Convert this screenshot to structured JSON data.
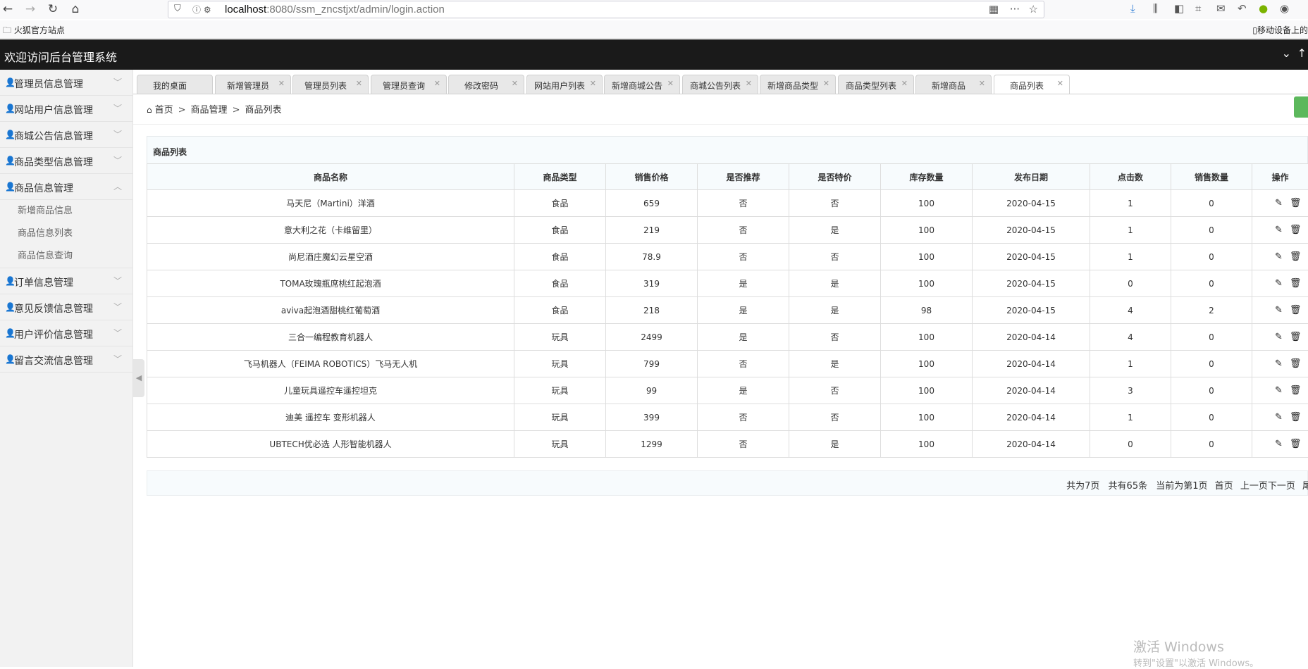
{
  "browser": {
    "url_host": "localhost",
    "url_rest": ":8080/ssm_zncstjxt/admin/login.action",
    "bookmark": "火狐官方站点",
    "mobile_bookmarks": "移动设备上的"
  },
  "app": {
    "title": "欢迎访问后台管理系统"
  },
  "sidebar": {
    "items": [
      {
        "label": "管理员信息管理",
        "expanded": false
      },
      {
        "label": "网站用户信息管理",
        "expanded": false
      },
      {
        "label": "商城公告信息管理",
        "expanded": false
      },
      {
        "label": "商品类型信息管理",
        "expanded": false
      },
      {
        "label": "商品信息管理",
        "expanded": true
      },
      {
        "label": "订单信息管理",
        "expanded": false
      },
      {
        "label": "意见反馈信息管理",
        "expanded": false
      },
      {
        "label": "用户评价信息管理",
        "expanded": false
      },
      {
        "label": "留言交流信息管理",
        "expanded": false
      }
    ],
    "submenu": [
      "新增商品信息",
      "商品信息列表",
      "商品信息查询"
    ]
  },
  "tabs": [
    {
      "label": "我的桌面",
      "closable": false
    },
    {
      "label": "新增管理员",
      "closable": true
    },
    {
      "label": "管理员列表",
      "closable": true
    },
    {
      "label": "管理员查询",
      "closable": true
    },
    {
      "label": "修改密码",
      "closable": true
    },
    {
      "label": "网站用户列表",
      "closable": true
    },
    {
      "label": "新增商城公告",
      "closable": true
    },
    {
      "label": "商城公告列表",
      "closable": true
    },
    {
      "label": "新增商品类型",
      "closable": true
    },
    {
      "label": "商品类型列表",
      "closable": true
    },
    {
      "label": "新增商品",
      "closable": true
    },
    {
      "label": "商品列表",
      "closable": true,
      "active": true
    }
  ],
  "breadcrumb": [
    "首页",
    "商品管理",
    "商品列表"
  ],
  "table": {
    "title": "商品列表",
    "headers": [
      "商品名称",
      "商品类型",
      "销售价格",
      "是否推荐",
      "是否特价",
      "库存数量",
      "发布日期",
      "点击数",
      "销售数量",
      "操作"
    ],
    "rows": [
      [
        "马天尼（Martini）洋酒",
        "食品",
        "659",
        "否",
        "否",
        "100",
        "2020-04-15",
        "1",
        "0"
      ],
      [
        "意大利之花（卡维留里）",
        "食品",
        "219",
        "否",
        "是",
        "100",
        "2020-04-15",
        "1",
        "0"
      ],
      [
        "尚尼酒庄魔幻云星空酒",
        "食品",
        "78.9",
        "否",
        "否",
        "100",
        "2020-04-15",
        "1",
        "0"
      ],
      [
        "TOMA玫瑰瓶席桃红起泡酒",
        "食品",
        "319",
        "是",
        "是",
        "100",
        "2020-04-15",
        "0",
        "0"
      ],
      [
        "aviva起泡酒甜桃红葡萄酒",
        "食品",
        "218",
        "是",
        "是",
        "98",
        "2020-04-15",
        "4",
        "2"
      ],
      [
        "三合一编程教育机器人",
        "玩具",
        "2499",
        "是",
        "否",
        "100",
        "2020-04-14",
        "4",
        "0"
      ],
      [
        "飞马机器人（FEIMA ROBOTICS）飞马无人机",
        "玩具",
        "799",
        "否",
        "是",
        "100",
        "2020-04-14",
        "1",
        "0"
      ],
      [
        "儿童玩具遥控车遥控坦克",
        "玩具",
        "99",
        "是",
        "否",
        "100",
        "2020-04-14",
        "3",
        "0"
      ],
      [
        "迪美 遥控车 变形机器人",
        "玩具",
        "399",
        "否",
        "否",
        "100",
        "2020-04-14",
        "1",
        "0"
      ],
      [
        "UBTECH优必选 人形智能机器人",
        "玩具",
        "1299",
        "否",
        "是",
        "100",
        "2020-04-14",
        "0",
        "0"
      ]
    ]
  },
  "pager": {
    "total_pages": "共为7页",
    "total_records": "共有65条",
    "current": "当前为第1页",
    "first": "首页",
    "prev": "上一页",
    "next": "下一页",
    "last": "尾"
  },
  "watermark": {
    "title": "激活 Windows",
    "sub": "转到\"设置\"以激活 Windows。"
  }
}
